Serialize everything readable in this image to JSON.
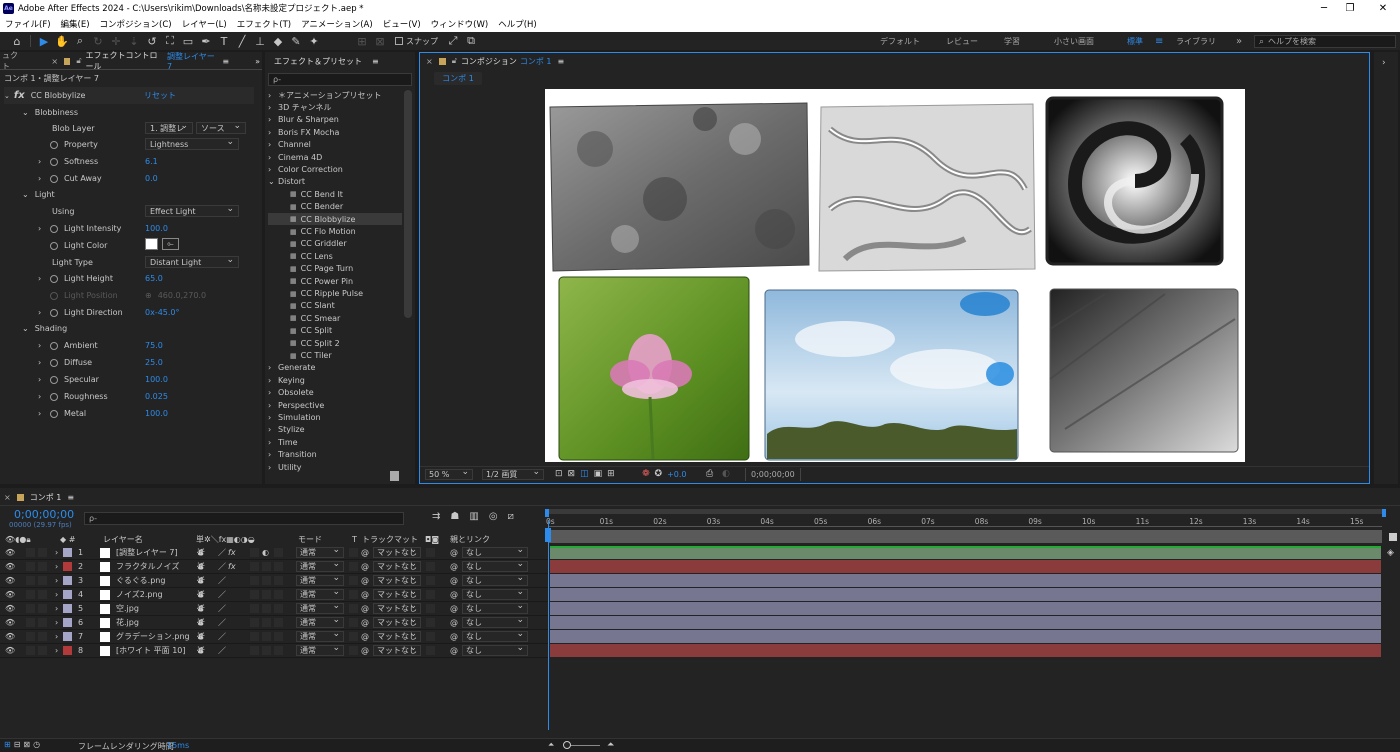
{
  "window": {
    "title": "Adobe After Effects 2024 - C:\\Users\\rikim\\Downloads\\名称未設定プロジェクト.aep *",
    "app_icon": "Ae",
    "controls": [
      "─",
      "❐",
      "✕"
    ]
  },
  "menu": [
    "ファイル(F)",
    "編集(E)",
    "コンポジション(C)",
    "レイヤー(L)",
    "エフェクト(T)",
    "アニメーション(A)",
    "ビュー(V)",
    "ウィンドウ(W)",
    "ヘルプ(H)"
  ],
  "toolbar": {
    "snap_label": "スナップ",
    "workspaces": [
      "デフォルト",
      "レビュー",
      "学習",
      "小さい画面",
      "標準",
      "ライブラリ"
    ],
    "active_workspace": "標準",
    "help_placeholder": "ヘルプを検索"
  },
  "effect_controls": {
    "panel_prefix": "ュクト",
    "tab_label": "エフェクトコントロール",
    "tab_layer": "調整レイヤー 7",
    "layer_path": "コンポ 1・調整レイヤー 7",
    "effect_name": "CC Blobbylize",
    "reset": "リセット",
    "blobbiness": "Blobbiness",
    "blob_layer": "Blob Layer",
    "blob_layer_value": "1. 調整レ",
    "blob_source": "ソース",
    "property": "Property",
    "property_value": "Lightness",
    "softness": "Softness",
    "softness_value": "6.1",
    "cut_away": "Cut Away",
    "cut_away_value": "0.0",
    "light": "Light",
    "using": "Using",
    "using_value": "Effect Light",
    "light_intensity": "Light Intensity",
    "light_intensity_value": "100.0",
    "light_color": "Light Color",
    "light_color_hex": "#ffffff",
    "light_type": "Light Type",
    "light_type_value": "Distant Light",
    "light_height": "Light Height",
    "light_height_value": "65.0",
    "light_position": "Light Position",
    "light_position_value": "460.0,270.0",
    "light_direction": "Light Direction",
    "light_direction_value": "0x-45.0°",
    "shading": "Shading",
    "ambient": "Ambient",
    "ambient_value": "75.0",
    "diffuse": "Diffuse",
    "diffuse_value": "25.0",
    "specular": "Specular",
    "specular_value": "100.0",
    "roughness": "Roughness",
    "roughness_value": "0.025",
    "metal": "Metal",
    "metal_value": "100.0"
  },
  "effects_presets": {
    "tab_label": "エフェクト＆プリセット",
    "search_placeholder": "ρ-",
    "categories_top": [
      "＊アニメーションプリセット",
      "3D チャンネル",
      "Blur & Sharpen",
      "Boris FX Mocha",
      "Channel",
      "Cinema 4D",
      "Color Correction",
      "Distort"
    ],
    "distort_items": [
      "CC Bend It",
      "CC Bender",
      "CC Blobbylize",
      "CC Flo Motion",
      "CC Griddler",
      "CC Lens",
      "CC Page Turn",
      "CC Power Pin",
      "CC Ripple Pulse",
      "CC Slant",
      "CC Smear",
      "CC Split",
      "CC Split 2",
      "CC Tiler"
    ],
    "selected_item": "CC Blobbylize",
    "categories_bottom": [
      "Generate",
      "Keying",
      "Obsolete",
      "Perspective",
      "Simulation",
      "Stylize",
      "Time",
      "Transition",
      "Utility"
    ]
  },
  "composition": {
    "tab_prefix": "コンポジション",
    "tab_name": "コンポ 1",
    "breadcrumb": "コンポ 1",
    "zoom": "50 %",
    "resolution": "1/2 画質",
    "exposure": "+0.0",
    "timecode": "0;00;00;00"
  },
  "timeline": {
    "tab_label": "コンポ 1",
    "current_time": "0;00;00;00",
    "fps": "00000 (29.97 fps)",
    "search_placeholder": "ρ-",
    "headers": {
      "layer_name": "レイヤー名",
      "switches": "単✲＼fx▦◐◑◒",
      "mode": "モード",
      "t": "T",
      "track_matte": "トラックマット",
      "parent": "親とリンク"
    },
    "ticks": [
      "0s",
      "01s",
      "02s",
      "03s",
      "04s",
      "05s",
      "06s",
      "07s",
      "08s",
      "09s",
      "10s",
      "11s",
      "12s",
      "13s",
      "14s",
      "15s"
    ],
    "layers": [
      {
        "num": "1",
        "name": "[調整レイヤー 7]",
        "label": "#a5a5c8",
        "fx": true,
        "mode": "通常",
        "matte": "マットなし",
        "parent": "なし",
        "bar": "#6b8a6b"
      },
      {
        "num": "2",
        "name": "フラクタルノイズ",
        "label": "#b33a3a",
        "fx": true,
        "mode": "通常",
        "matte": "マットなし",
        "parent": "なし",
        "bar": "#8a3b3b"
      },
      {
        "num": "3",
        "name": "ぐるぐる.png",
        "label": "#a5a5c8",
        "fx": false,
        "mode": "通常",
        "matte": "マットなし",
        "parent": "なし",
        "bar": "#767690"
      },
      {
        "num": "4",
        "name": "ノイズ2.png",
        "label": "#a5a5c8",
        "fx": false,
        "mode": "通常",
        "matte": "マットなし",
        "parent": "なし",
        "bar": "#767690"
      },
      {
        "num": "5",
        "name": "空.jpg",
        "label": "#a5a5c8",
        "fx": false,
        "mode": "通常",
        "matte": "マットなし",
        "parent": "なし",
        "bar": "#767690"
      },
      {
        "num": "6",
        "name": "花.jpg",
        "label": "#a5a5c8",
        "fx": false,
        "mode": "通常",
        "matte": "マットなし",
        "parent": "なし",
        "bar": "#767690"
      },
      {
        "num": "7",
        "name": "グラデーション.png",
        "label": "#a5a5c8",
        "fx": false,
        "mode": "通常",
        "matte": "マットなし",
        "parent": "なし",
        "bar": "#767690"
      },
      {
        "num": "8",
        "name": "[ホワイト 平面 10]",
        "label": "#b33a3a",
        "fx": false,
        "mode": "通常",
        "matte": "マットなし",
        "parent": "なし",
        "bar": "#8a3b3b"
      }
    ],
    "render_time_label": "フレームレンダリング時間",
    "render_time_value": "15ms"
  },
  "colors": {
    "accent": "#2d8ceb",
    "panel": "#232323",
    "bg": "#1c1c1c"
  }
}
